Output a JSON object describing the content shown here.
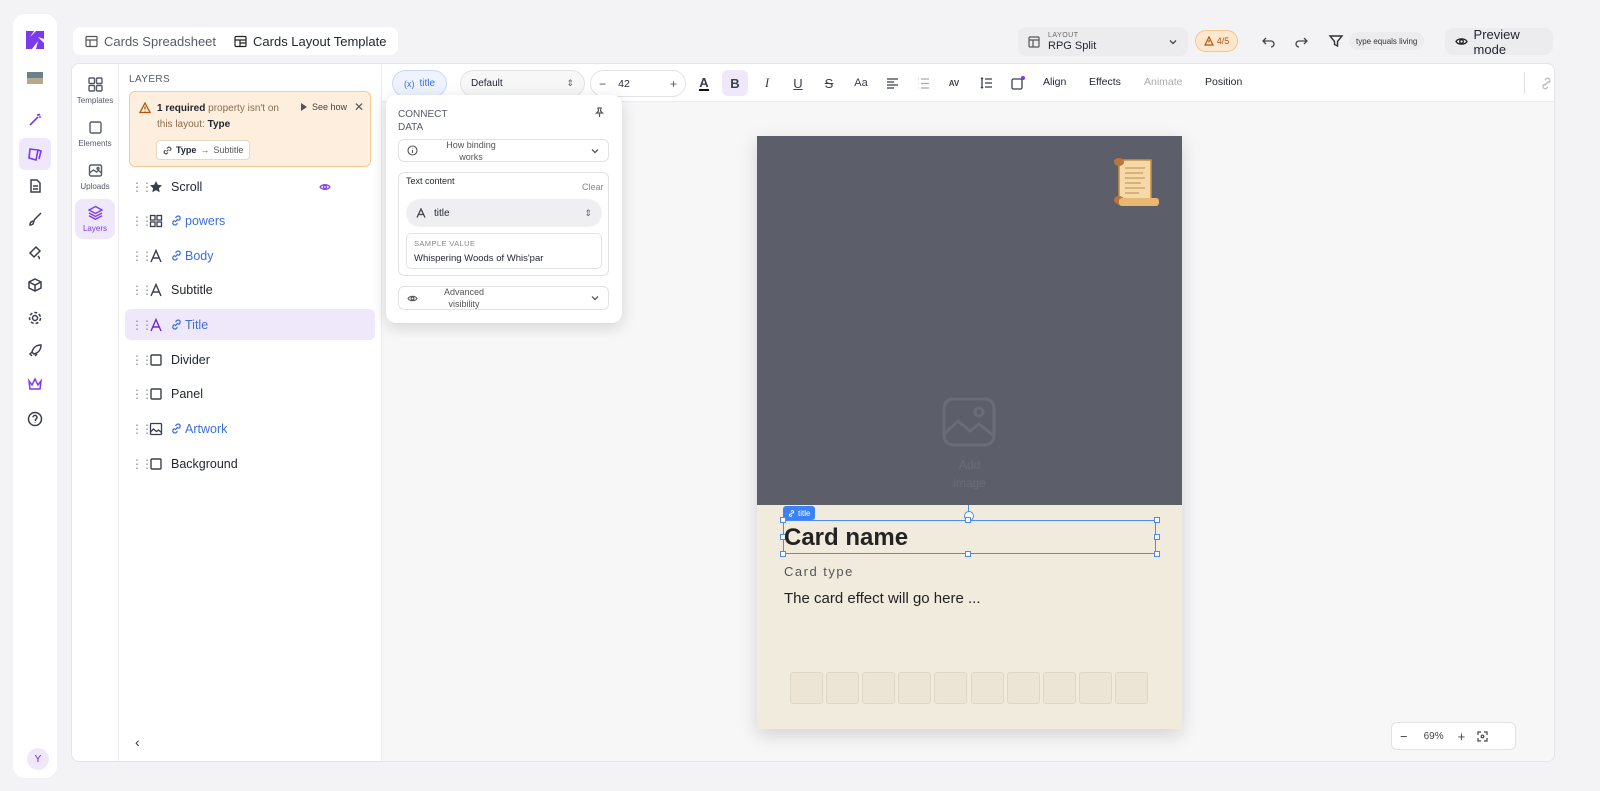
{
  "tabs": [
    {
      "label": "Cards Spreadsheet"
    },
    {
      "label": "Cards Layout Template"
    }
  ],
  "layout_selector": {
    "label": "LAYOUT",
    "value": "RPG Split"
  },
  "warnings_count": "4/5",
  "filter": "type equals living",
  "preview_label": "Preview mode",
  "subnav": [
    {
      "label": "Templates"
    },
    {
      "label": "Elements"
    },
    {
      "label": "Uploads"
    },
    {
      "label": "Layers"
    }
  ],
  "layers": {
    "title": "LAYERS",
    "warning": {
      "bold": "1 required",
      "text": " property isn't on this layout: ",
      "prop": "Type",
      "see_how": "See how",
      "chip_from": "Type",
      "chip_to": "Subtitle"
    },
    "items": [
      {
        "label": "Scroll",
        "icon": "star-icon",
        "bound": false
      },
      {
        "label": "powers",
        "icon": "grid-icon",
        "bound": true
      },
      {
        "label": "Body",
        "icon": "text-icon",
        "bound": true
      },
      {
        "label": "Subtitle",
        "icon": "text-icon",
        "bound": false
      },
      {
        "label": "Title",
        "icon": "text-icon",
        "bound": true
      },
      {
        "label": "Divider",
        "icon": "square-icon",
        "bound": false
      },
      {
        "label": "Panel",
        "icon": "square-icon",
        "bound": false
      },
      {
        "label": "Artwork",
        "icon": "image-icon",
        "bound": true
      },
      {
        "label": "Background",
        "icon": "square-icon",
        "bound": false
      }
    ]
  },
  "toolbar": {
    "var_pill": "title",
    "font": "Default",
    "size": "42",
    "align": "Align",
    "effects": "Effects",
    "animate": "Animate",
    "position": "Position"
  },
  "connect": {
    "title": "CONNECT DATA",
    "how": "How binding works",
    "text_content": "Text content",
    "clear": "Clear",
    "field": "title",
    "sample_label": "SAMPLE VALUE",
    "sample_value": "Whispering Woods of Whis'par",
    "advanced": "Advanced visibility"
  },
  "card": {
    "add_image": "Add image",
    "tag": "title",
    "name": "Card name",
    "type": "Card type",
    "effect": "The card effect will go here ..."
  },
  "zoom": "69%",
  "avatar": "Y",
  "colors": {
    "accent": "#7c3aed",
    "selection": "#4a8cf0",
    "art_bg": "#5c5f69",
    "card_bg": "#f1ebdd",
    "warning_bg": "#fdeedd"
  }
}
